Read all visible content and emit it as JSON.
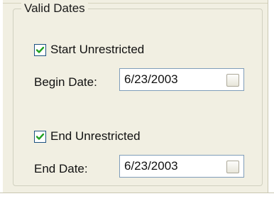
{
  "group": {
    "title": "Valid Dates"
  },
  "start": {
    "checkbox_label": "Start Unrestricted",
    "checked": true,
    "date_label": "Begin Date:",
    "date_value": "6/23/2003"
  },
  "end": {
    "checkbox_label": "End Unrestricted",
    "checked": true,
    "date_label": "End Date:",
    "date_value": "6/23/2003"
  },
  "icons": {
    "check": "check-mark-icon",
    "picker": "date-picker-button"
  },
  "colors": {
    "panel_bg": "#f1efe2",
    "check_mark": "#21a121",
    "field_border": "#7f9db9"
  }
}
